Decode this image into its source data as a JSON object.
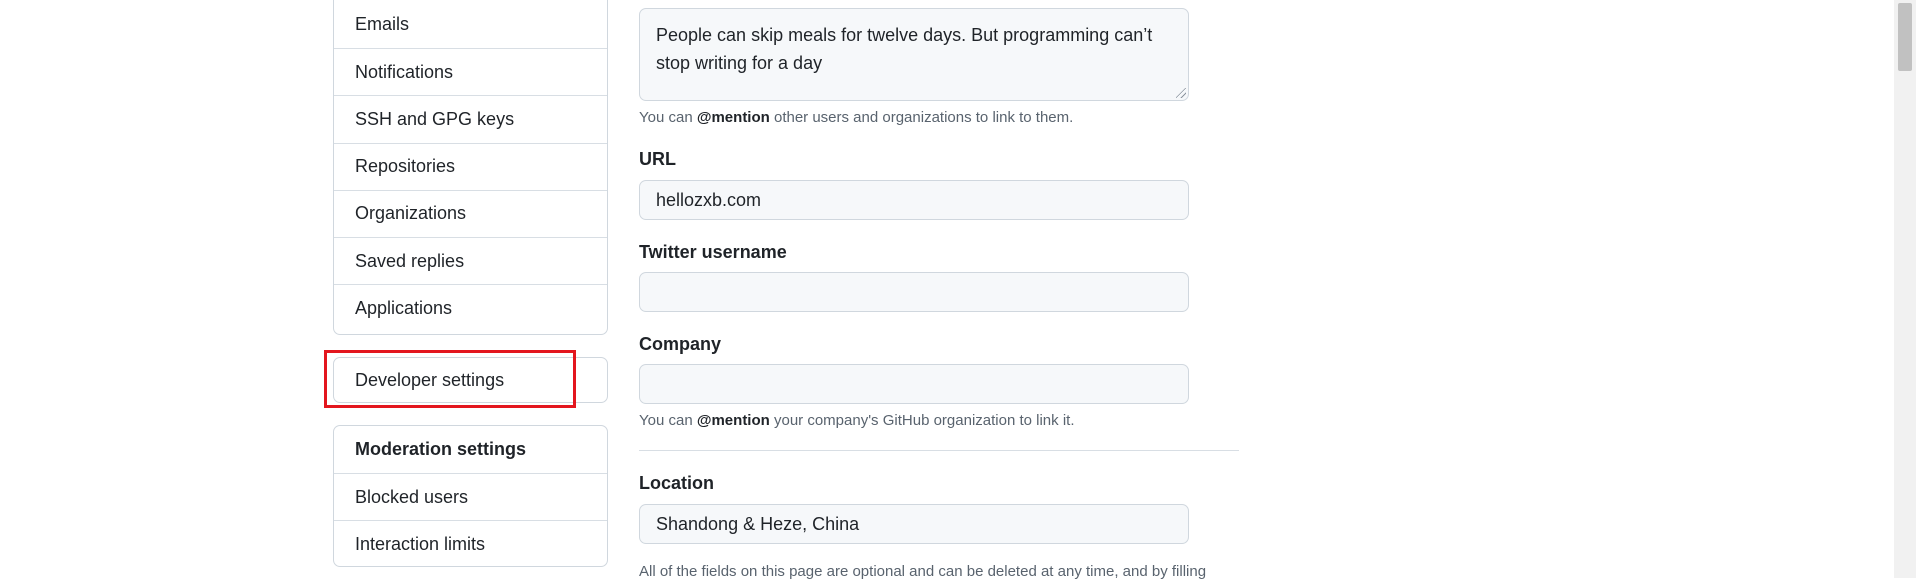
{
  "sidebar": {
    "items": [
      {
        "label": "Emails"
      },
      {
        "label": "Notifications"
      },
      {
        "label": "SSH and GPG keys"
      },
      {
        "label": "Repositories"
      },
      {
        "label": "Organizations"
      },
      {
        "label": "Saved replies"
      },
      {
        "label": "Applications"
      }
    ],
    "developer_settings": "Developer settings",
    "moderation": {
      "heading": "Moderation settings",
      "items": [
        {
          "label": "Blocked users"
        },
        {
          "label": "Interaction limits"
        }
      ]
    }
  },
  "profile": {
    "bio": {
      "value": "People can skip meals for twelve days. But programming can’t stop writing for a day",
      "note_prefix": "You can ",
      "note_mention": "@mention",
      "note_suffix": " other users and organizations to link to them."
    },
    "url": {
      "label": "URL",
      "value": "hellozxb.com"
    },
    "twitter": {
      "label": "Twitter username",
      "value": ""
    },
    "company": {
      "label": "Company",
      "value": "",
      "note_prefix": "You can ",
      "note_mention": "@mention",
      "note_suffix": " your company's GitHub organization to link it."
    },
    "location": {
      "label": "Location",
      "value": "Shandong & Heze, China"
    },
    "footer_note": "All of the fields on this page are optional and can be deleted at any time, and by filling"
  },
  "annotation": {
    "color": "#e3161e"
  }
}
